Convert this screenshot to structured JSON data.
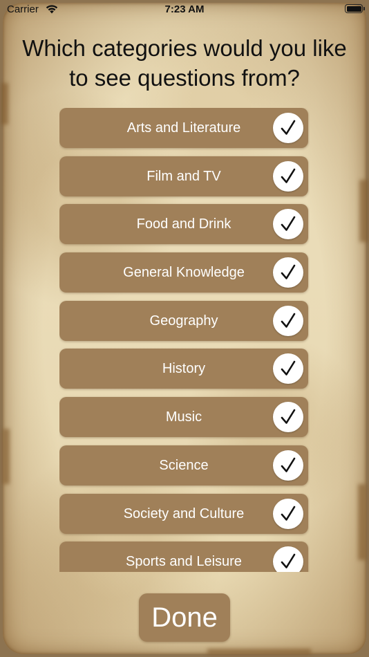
{
  "status_bar": {
    "carrier": "Carrier",
    "time": "7:23 AM"
  },
  "question": "Which categories would you like to see questions from?",
  "categories": [
    {
      "label": "Arts and Literature",
      "checked": true
    },
    {
      "label": "Film and TV",
      "checked": true
    },
    {
      "label": "Food and Drink",
      "checked": true
    },
    {
      "label": "General Knowledge",
      "checked": true
    },
    {
      "label": "Geography",
      "checked": true
    },
    {
      "label": "History",
      "checked": true
    },
    {
      "label": "Music",
      "checked": true
    },
    {
      "label": "Science",
      "checked": true
    },
    {
      "label": "Society and Culture",
      "checked": true
    },
    {
      "label": "Sports and Leisure",
      "checked": true
    }
  ],
  "done_label": "Done",
  "colors": {
    "row_background": "#a08059",
    "parchment": "#e9dbb6",
    "frame": "#8d7350",
    "checkmark": "#111111"
  },
  "icons": {
    "checkmark": "checkmark-icon",
    "wifi": "wifi-icon",
    "battery": "battery-icon"
  }
}
